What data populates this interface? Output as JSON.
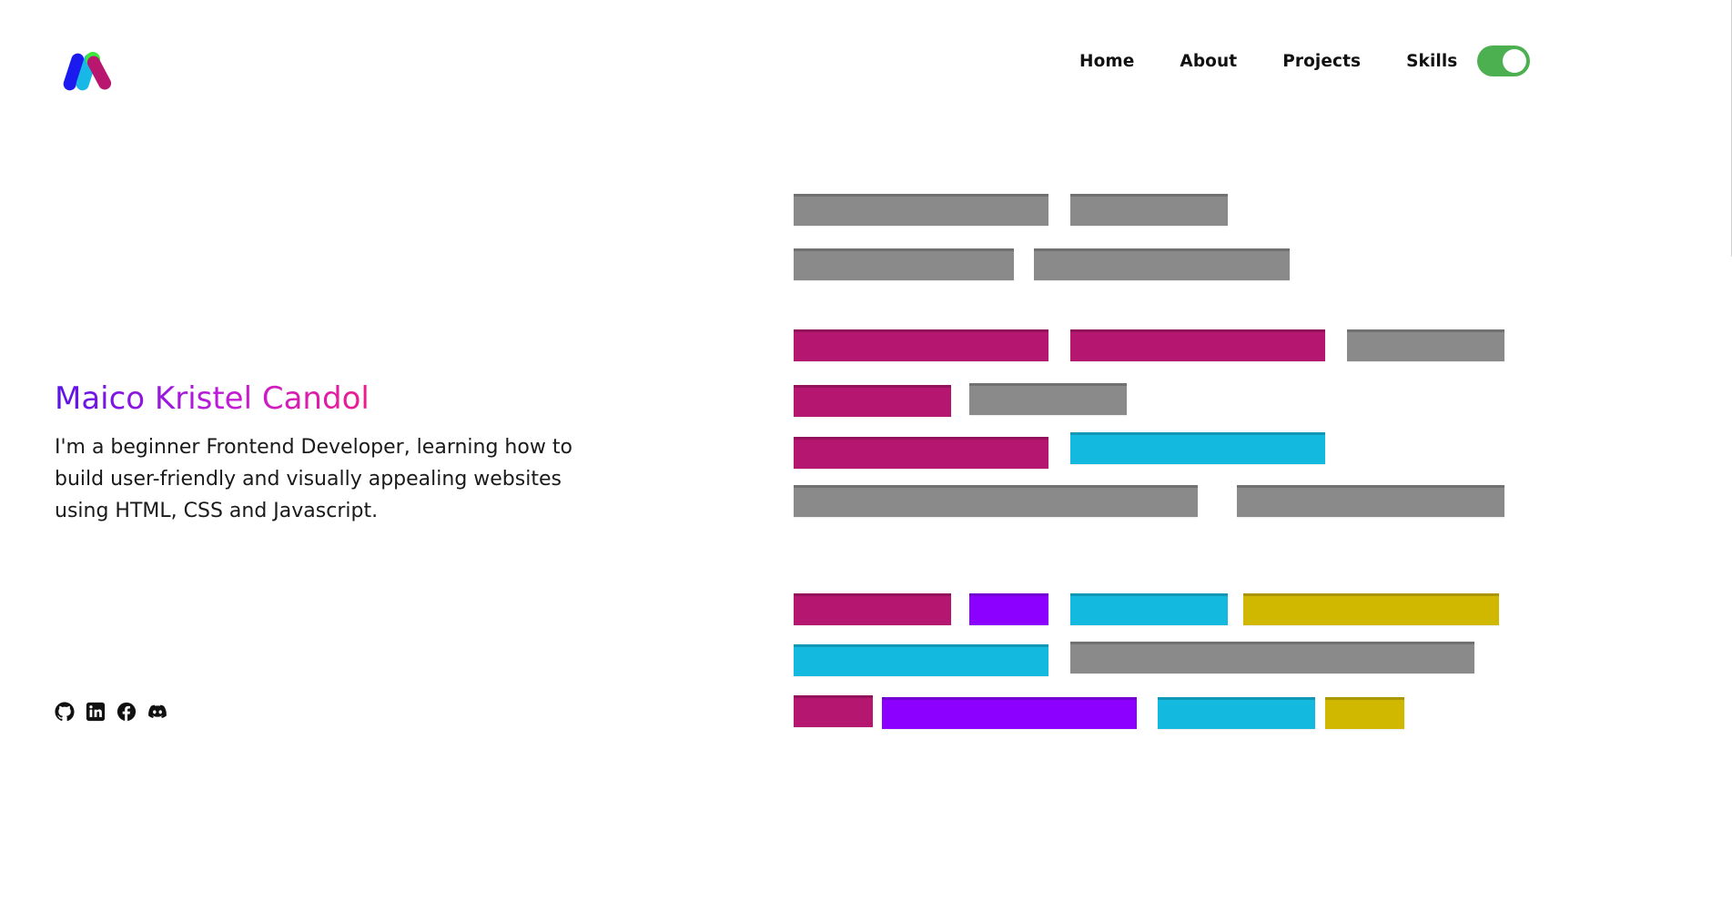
{
  "nav": {
    "links": [
      "Home",
      "About",
      "Projects",
      "Skills"
    ],
    "theme_toggle_on": true
  },
  "hero": {
    "name": "Maico Kristel Candol",
    "description": "I'm a beginner Frontend Developer, learning how to build user-friendly and visually appealing websites using HTML, CSS and Javascript."
  },
  "socials": [
    "github-icon",
    "linkedin-icon",
    "facebook-icon",
    "discord-icon"
  ],
  "colors": {
    "toggle": "#4caf50",
    "gray": "#8a8a8a",
    "magenta": "#b5166f",
    "purple": "#8b00ff",
    "cyan": "#14b9df",
    "yellow": "#d1b800",
    "name_gradient": [
      "#5a14e6",
      "#c21bd8",
      "#ee1c8e"
    ]
  }
}
